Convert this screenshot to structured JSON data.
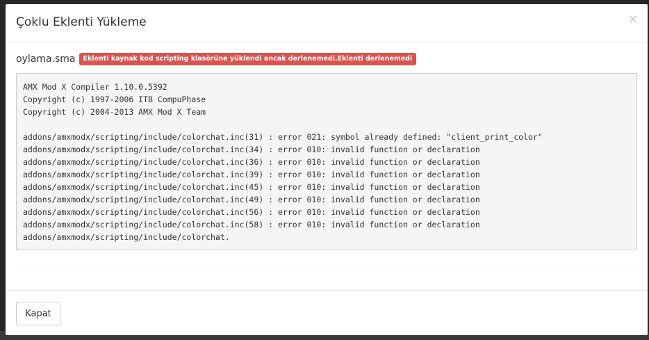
{
  "modal": {
    "title": "Çoklu Eklenti Yükleme",
    "close_symbol": "×"
  },
  "upload": {
    "file_name": "oylama.sma",
    "status_badge": "Eklenti kaynak kod scripting klasörüne yüklendi ancak derlenemedi.Eklenti derlenemedi",
    "status_color": "#d9534f"
  },
  "log": {
    "lines": [
      "AMX Mod X Compiler 1.10.0.5392",
      "Copyright (c) 1997-2006 ITB CompuPhase",
      "Copyright (c) 2004-2013 AMX Mod X Team",
      "",
      "addons/amxmodx/scripting/include/colorchat.inc(31) : error 021: symbol already defined: \"client_print_color\"",
      "addons/amxmodx/scripting/include/colorchat.inc(34) : error 010: invalid function or declaration",
      "addons/amxmodx/scripting/include/colorchat.inc(36) : error 010: invalid function or declaration",
      "addons/amxmodx/scripting/include/colorchat.inc(39) : error 010: invalid function or declaration",
      "addons/amxmodx/scripting/include/colorchat.inc(45) : error 010: invalid function or declaration",
      "addons/amxmodx/scripting/include/colorchat.inc(49) : error 010: invalid function or declaration",
      "addons/amxmodx/scripting/include/colorchat.inc(56) : error 010: invalid function or declaration",
      "addons/amxmodx/scripting/include/colorchat.inc(58) : error 010: invalid function or declaration",
      "addons/amxmodx/scripting/include/colorchat."
    ]
  },
  "footer": {
    "close_label": "Kapat"
  }
}
